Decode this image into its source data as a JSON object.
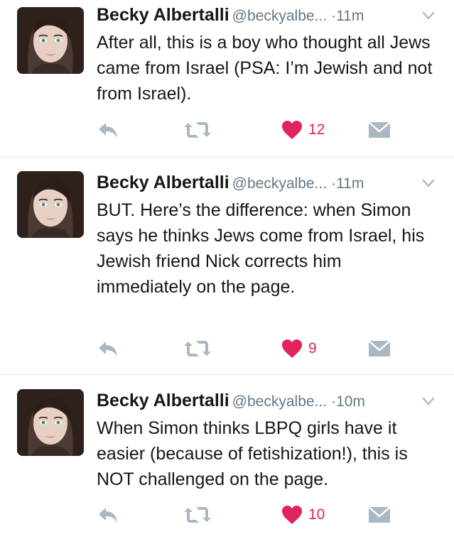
{
  "tweets": [
    {
      "name": "Becky Albertalli",
      "handle": "@beckyalbe...",
      "separator": "·",
      "time": "11m",
      "text": "After all, this is a boy who thought all Jews came from Israel (PSA: I’m Jewish and not from Israel).",
      "likes": "12"
    },
    {
      "name": "Becky Albertalli",
      "handle": "@beckyalbe...",
      "separator": "·",
      "time": "11m",
      "text": "BUT. Here’s the difference: when Simon says he thinks Jews come from Israel, his Jewish friend Nick corrects him immediately on the page.",
      "likes": "9"
    },
    {
      "name": "Becky Albertalli",
      "handle": "@beckyalbe...",
      "separator": "·",
      "time": "10m",
      "text": "When Simon thinks LBPQ girls have it easier (because of fetishization!), this is NOT challenged on the page.",
      "likes": "10"
    }
  ],
  "icons": {
    "reply": "reply-icon",
    "retweet": "retweet-icon",
    "like": "heart-icon",
    "message": "direct-message-icon",
    "menu": "chevron-down-icon"
  },
  "colors": {
    "text": "#14171a",
    "muted": "#657786",
    "icon": "#aab8c2",
    "like": "#e0245e",
    "divider": "#e1e8ed"
  }
}
